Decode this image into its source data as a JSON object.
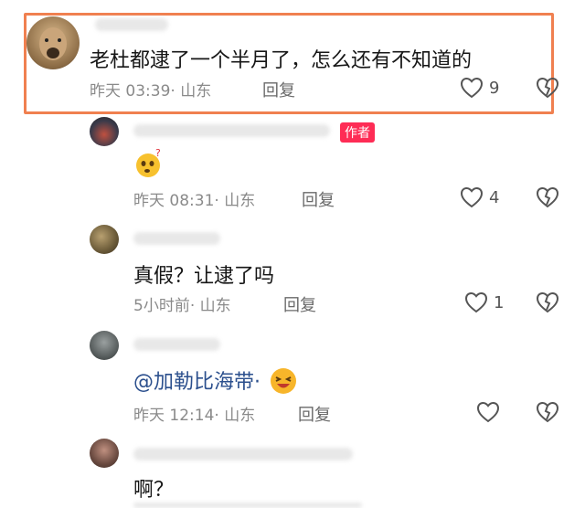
{
  "comments": [
    {
      "text": "老杜都逮了一个半月了，怎么还有不知道的",
      "time": "昨天 03:39",
      "location": "· 山东",
      "reply_label": "回复",
      "likes": "9"
    },
    {
      "author_badge": "作者",
      "time": "昨天 08:31",
      "location": "· 山东",
      "reply_label": "回复",
      "likes": "4"
    },
    {
      "text": "真假？让逮了吗",
      "time": "5小时前",
      "location": "· 山东",
      "reply_label": "回复",
      "likes": "1"
    },
    {
      "mention": "@加勒比海带·",
      "time": "昨天 12:14",
      "location": "· 山东",
      "reply_label": "回复"
    },
    {
      "text": "啊？"
    }
  ],
  "colors": {
    "highlight_border": "#f08050",
    "badge_bg": "#fe2c55",
    "mention": "#2b4f8d"
  }
}
